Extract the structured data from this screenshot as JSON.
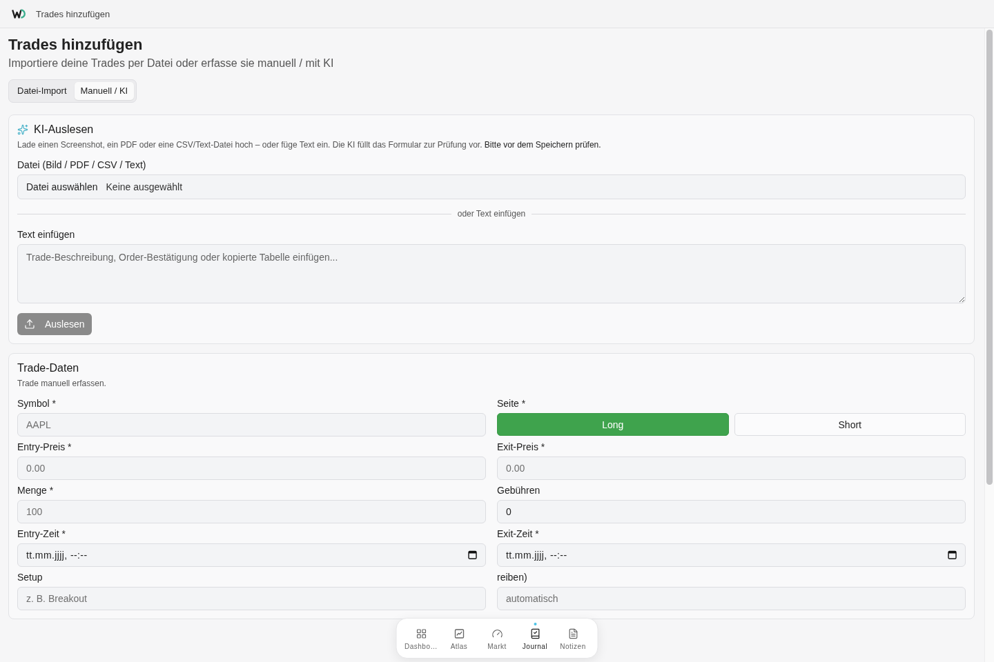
{
  "app_bar": {
    "title": "Trades hinzufügen"
  },
  "page": {
    "title": "Trades hinzufügen",
    "subtitle": "Importiere deine Trades per Datei oder erfasse sie manuell / mit KI"
  },
  "tabs": [
    {
      "label": "Datei-Import",
      "selected": false
    },
    {
      "label": "Manuell / KI",
      "selected": true
    }
  ],
  "ai_panel": {
    "title": "KI-Auslesen",
    "description": "Lade einen Screenshot, ein PDF oder eine CSV/Text-Datei hoch – oder füge Text ein. Die KI füllt das Formular zur Prüfung vor. **Bitte vor dem Speichern prüfen.**",
    "file_field": {
      "label": "Datei (Bild / PDF / CSV / Text)",
      "button": "Datei auswählen",
      "value": "Keine ausgewählt"
    },
    "divider": "oder Text einfügen",
    "text_field": {
      "label": "Text einfügen",
      "placeholder": "Trade-Beschreibung, Order-Bestätigung oder kopierte Tabelle einfügen..."
    },
    "submit": {
      "label": "Auslesen",
      "disabled": true
    }
  },
  "trade_form": {
    "title": "Trade-Daten",
    "subtitle": "Trade manuell erfassen.",
    "fields": [
      {
        "kind": "text",
        "label": "Symbol *",
        "placeholder": "AAPL"
      },
      {
        "kind": "toggle",
        "label": "Seite *",
        "options": [
          {
            "label": "Long",
            "selected": true
          },
          {
            "label": "Short",
            "selected": false
          }
        ]
      },
      {
        "kind": "text",
        "label": "Entry-Preis *",
        "placeholder": "0.00"
      },
      {
        "kind": "text",
        "label": "Exit-Preis *",
        "placeholder": "0.00"
      },
      {
        "kind": "text",
        "label": "Menge *",
        "placeholder": "100"
      },
      {
        "kind": "text",
        "label": "Gebühren",
        "value": "0"
      },
      {
        "kind": "datetime",
        "label": "Entry-Zeit *",
        "value": "tt.mm.jjjj, --:--"
      },
      {
        "kind": "datetime",
        "label": "Exit-Zeit *",
        "value": "tt.mm.jjjj, --:--"
      },
      {
        "kind": "text",
        "label": "Setup",
        "placeholder": "z. B. Breakout"
      },
      {
        "kind": "text",
        "label": "reiben)",
        "placeholder": "automatisch"
      }
    ]
  },
  "bottom_nav": {
    "items": [
      {
        "kind": "grid",
        "label": "Dashbo…",
        "selected": false
      },
      {
        "kind": "chart",
        "label": "Atlas",
        "selected": false
      },
      {
        "kind": "gauge",
        "label": "Markt",
        "selected": false
      },
      {
        "kind": "journal",
        "label": "Journal",
        "selected": true
      },
      {
        "kind": "notes",
        "label": "Notizen",
        "selected": false
      }
    ]
  }
}
